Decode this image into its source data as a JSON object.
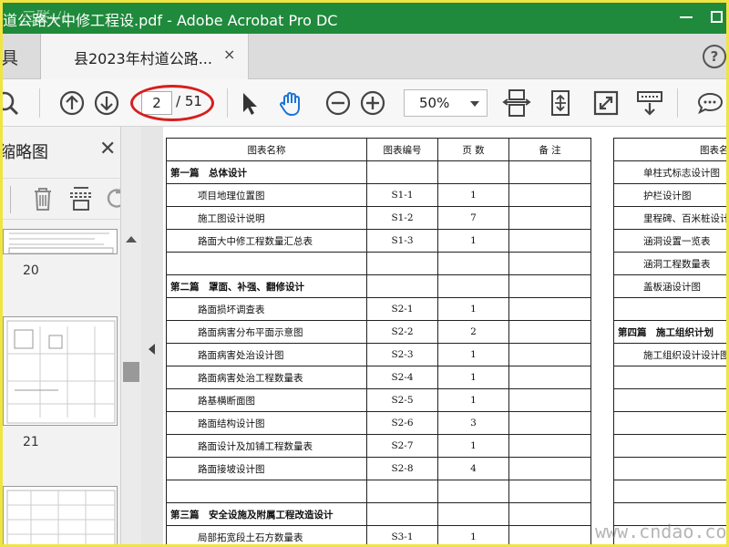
{
  "window": {
    "title": "道公路大中修工程设.pdf - Adobe Acrobat Pro DC",
    "watermark": "三联·八"
  },
  "tabs": {
    "home_label": "具",
    "doc_label": "县2023年村道公路...",
    "close_glyph": "×",
    "help_glyph": "?"
  },
  "toolbar": {
    "page_current": "2",
    "page_total": "/ 51",
    "zoom": "50%",
    "highlight_color": "#d81e1e"
  },
  "sidebar": {
    "title": "缩略图",
    "close_glyph": "✕",
    "thumbnails": [
      {
        "label": "20"
      },
      {
        "label": "21"
      }
    ]
  },
  "document": {
    "left_headers": [
      "图表名称",
      "图表编号",
      "页 数",
      "备 注"
    ],
    "left_rows": [
      {
        "type": "section",
        "name": "第一篇　总体设计",
        "code": "",
        "pages": ""
      },
      {
        "type": "item",
        "name": "项目地理位置图",
        "code": "S1-1",
        "pages": "1"
      },
      {
        "type": "item",
        "name": "施工图设计说明",
        "code": "S1-2",
        "pages": "7"
      },
      {
        "type": "item",
        "name": "路面大中修工程数量汇总表",
        "code": "S1-3",
        "pages": "1"
      },
      {
        "type": "blank",
        "name": "",
        "code": "",
        "pages": ""
      },
      {
        "type": "section",
        "name": "第二篇　罩面、补强、翻修设计",
        "code": "",
        "pages": ""
      },
      {
        "type": "item",
        "name": "路面损坏调查表",
        "code": "S2-1",
        "pages": "1"
      },
      {
        "type": "item",
        "name": "路面病害分布平面示意图",
        "code": "S2-2",
        "pages": "2"
      },
      {
        "type": "item",
        "name": "路面病害处治设计图",
        "code": "S2-3",
        "pages": "1"
      },
      {
        "type": "item",
        "name": "路面病害处治工程数量表",
        "code": "S2-4",
        "pages": "1"
      },
      {
        "type": "item",
        "name": "路基横断面图",
        "code": "S2-5",
        "pages": "1"
      },
      {
        "type": "item",
        "name": "路面结构设计图",
        "code": "S2-6",
        "pages": "3"
      },
      {
        "type": "item",
        "name": "路面设计及加铺工程数量表",
        "code": "S2-7",
        "pages": "1"
      },
      {
        "type": "item",
        "name": "路面接坡设计图",
        "code": "S2-8",
        "pages": "4"
      },
      {
        "type": "blank",
        "name": "",
        "code": "",
        "pages": ""
      },
      {
        "type": "section",
        "name": "第三篇　安全设施及附属工程改造设计",
        "code": "",
        "pages": ""
      },
      {
        "type": "item",
        "name": "局部拓宽段土石方数量表",
        "code": "S3-1",
        "pages": "1"
      }
    ],
    "right_header": "图表名称",
    "right_rows": [
      {
        "type": "item",
        "name": "单柱式标志设计图"
      },
      {
        "type": "item",
        "name": "护栏设计图"
      },
      {
        "type": "item",
        "name": "里程碑、百米桩设计"
      },
      {
        "type": "item",
        "name": "涵洞设置一览表"
      },
      {
        "type": "item",
        "name": "涵洞工程数量表"
      },
      {
        "type": "item",
        "name": "盖板涵设计图"
      },
      {
        "type": "blank",
        "name": ""
      },
      {
        "type": "section",
        "name": "第四篇　施工组织计划"
      },
      {
        "type": "item",
        "name": "施工组织设计设计图"
      },
      {
        "type": "blank",
        "name": ""
      },
      {
        "type": "blank",
        "name": ""
      },
      {
        "type": "blank",
        "name": ""
      },
      {
        "type": "blank",
        "name": ""
      },
      {
        "type": "blank",
        "name": ""
      },
      {
        "type": "blank",
        "name": ""
      },
      {
        "type": "blank",
        "name": ""
      },
      {
        "type": "blank",
        "name": ""
      }
    ],
    "site_watermark": "www.cndao.com"
  }
}
